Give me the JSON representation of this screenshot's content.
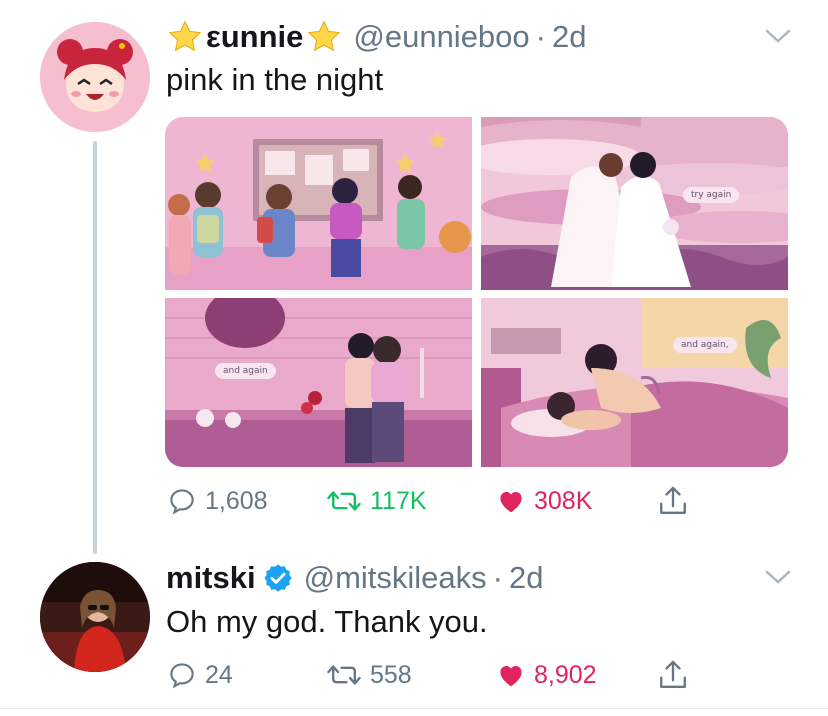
{
  "tweet1": {
    "display_name": "εunnie",
    "name_icons": [
      "star-icon",
      "star-icon"
    ],
    "handle": "@eunnieboo",
    "time": "2d",
    "text": "pink in the night",
    "media": {
      "panel_captions": [
        "try again",
        "and again",
        "and again,"
      ]
    },
    "replies": "1,608",
    "retweets": "117K",
    "likes": "308K",
    "liked": true
  },
  "tweet2": {
    "display_name": "mitski",
    "verified": true,
    "handle": "@mitskileaks",
    "time": "2d",
    "text": "Oh my god. Thank you.",
    "replies": "24",
    "retweets": "558",
    "likes": "8,902",
    "liked": true
  },
  "colors": {
    "accent_like": "#e0245e",
    "accent_retweet": "#17bf63",
    "verified": "#1da1f2",
    "muted": "#657786"
  },
  "separator": "·"
}
